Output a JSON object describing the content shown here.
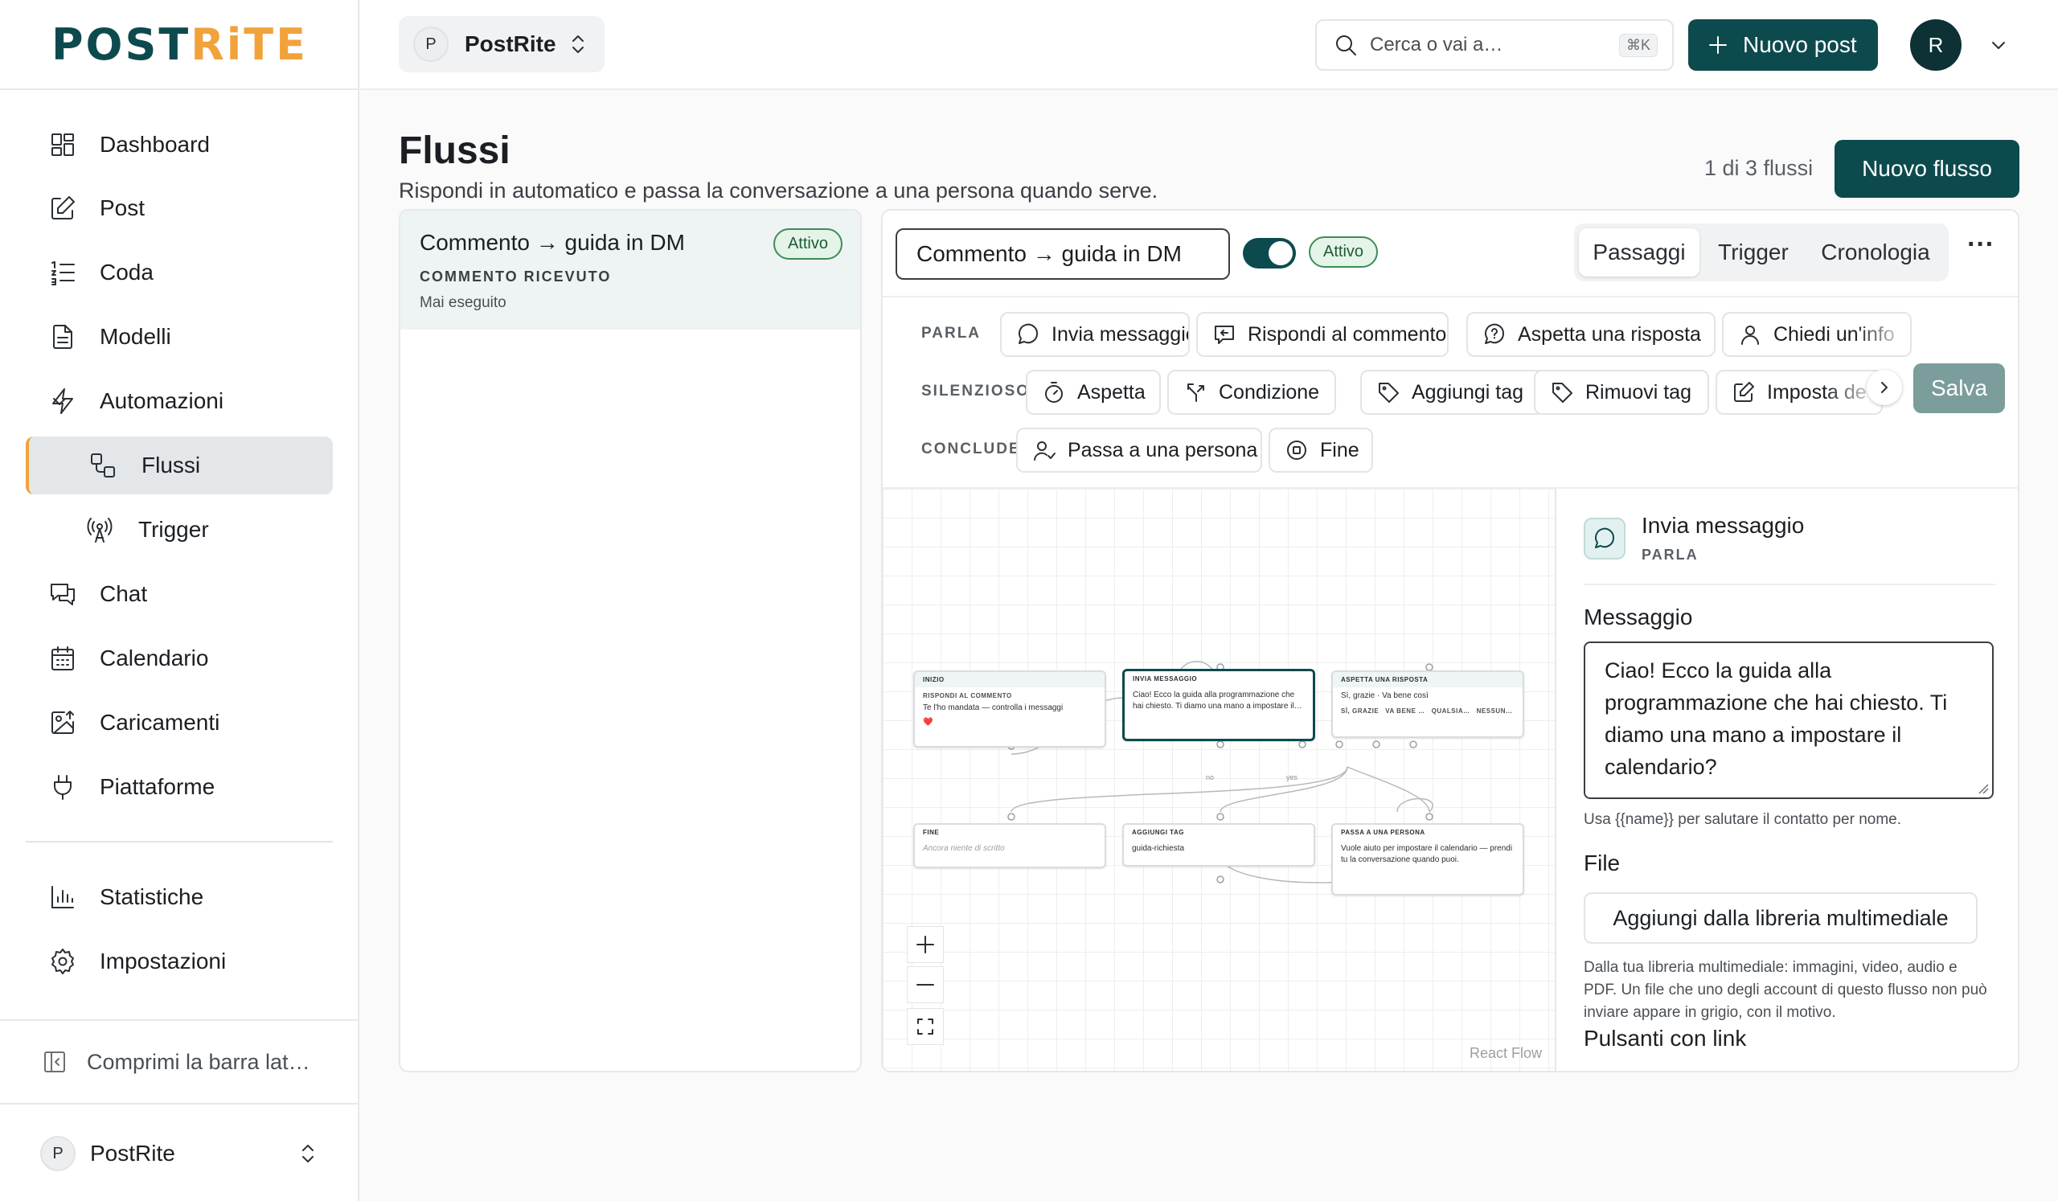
{
  "brand": {
    "logo_a": "POST",
    "logo_b": "RiTE"
  },
  "nav": {
    "dashboard": "Dashboard",
    "post": "Post",
    "coda": "Coda",
    "modelli": "Modelli",
    "automazioni": "Automazioni",
    "flussi": "Flussi",
    "trigger": "Trigger",
    "chat": "Chat",
    "calendario": "Calendario",
    "caricamenti": "Caricamenti",
    "piattaforme": "Piattaforme",
    "statistiche": "Statistiche",
    "impostazioni": "Impostazioni",
    "collapse": "Comprimi la barra lat…"
  },
  "workspace": {
    "initial": "P",
    "name": "PostRite"
  },
  "topbar": {
    "search_placeholder": "Cerca o vai a…",
    "search_shortcut": "⌘K",
    "new_post": "Nuovo post",
    "user_initial": "R"
  },
  "page": {
    "title": "Flussi",
    "subtitle": "Rispondi in automatico e passa la conversazione a una persona quando serve.",
    "count": "1 di 3 flussi",
    "new_flow": "Nuovo flusso"
  },
  "flow_list": [
    {
      "name": "Commento → guida in DM",
      "status": "Attivo",
      "trigger": "COMMENTO RICEVUTO",
      "last_run": "Mai eseguito"
    }
  ],
  "editor": {
    "flow_name": "Commento → guida in DM",
    "status": "Attivo",
    "tabs": [
      "Passaggi",
      "Trigger",
      "Cronologia"
    ],
    "more": "···",
    "save": "Salva"
  },
  "palette": {
    "parla": {
      "label": "PARLA",
      "items": [
        "Invia messaggio",
        "Rispondi al commento",
        "Aspetta una risposta",
        "Chiedi un'info"
      ]
    },
    "silenzioso": {
      "label": "SILENZIOSO",
      "items": [
        "Aspetta",
        "Condizione",
        "Aggiungi tag",
        "Rimuovi tag",
        "Imposta de"
      ]
    },
    "conclude": {
      "label": "CONCLUDE",
      "items": [
        "Passa a una persona",
        "Fine"
      ]
    }
  },
  "canvas": {
    "nodes": {
      "inizio": {
        "header": "INIZIO",
        "kicker": "RISPONDI AL COMMENTO",
        "text": "Te l'ho mandata — controlla i messaggi",
        "emoji": "❤️"
      },
      "invia": {
        "header": "INVIA MESSAGGIO",
        "text": "Ciao! Ecco la guida alla programmazione che hai chiesto. Ti diamo una mano a impostare il…"
      },
      "aspetta": {
        "header": "ASPETTA UNA RISPOSTA",
        "text": "Sì, grazie · Va bene così",
        "options": [
          "SÌ, GRAZIE",
          "VA BENE …",
          "QUALSIA…",
          "NESSUN…"
        ]
      },
      "fine": {
        "header": "FINE",
        "text": "Ancora niente di scritto"
      },
      "tag": {
        "header": "AGGIUNGI TAG",
        "text": "guida-richiesta"
      },
      "persona": {
        "header": "PASSA A UNA PERSONA",
        "text": "Vuole aiuto per impostare il calendario — prendi tu la conversazione quando puoi."
      }
    },
    "edge_labels": {
      "no": "no",
      "yes": "yes"
    },
    "attribution": "React Flow"
  },
  "inspector": {
    "title": "Invia messaggio",
    "category": "PARLA",
    "message_label": "Messaggio",
    "message": "Ciao! Ecco la guida alla programmazione che hai chiesto. Ti diamo una mano a impostare il calendario?",
    "message_hint": "Usa {{name}} per salutare il contatto per nome.",
    "file_label": "File",
    "media_button": "Aggiungi dalla libreria multimediale",
    "file_hint": "Dalla tua libreria multimediale: immagini, video, audio e PDF. Un file che uno degli account di questo flusso non può inviare appare in grigio, con il motivo.",
    "buttons_label": "Pulsanti con link"
  },
  "colors": {
    "brand_dark": "#0d4a4e",
    "brand_accent": "#f2a23b",
    "active_green": "#3f8c59",
    "save_disabled": "#7b9d9b"
  }
}
